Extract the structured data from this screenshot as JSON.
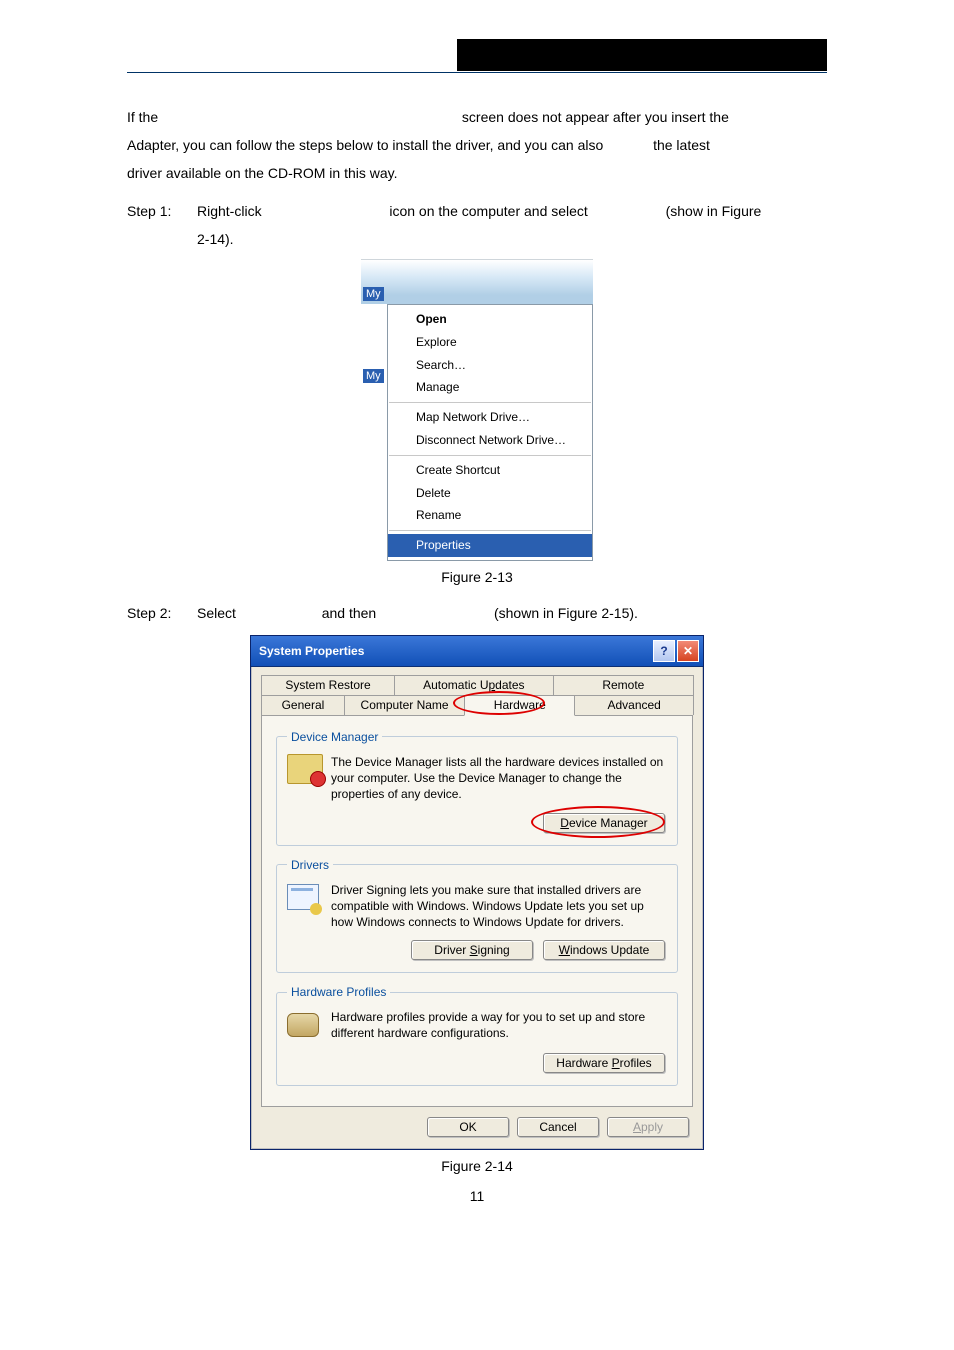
{
  "body": {
    "para1_a": "If the",
    "para1_b": "screen does not appear after you insert the",
    "para2_a": "Adapter, you can follow the steps below to install the driver, and you can also",
    "para2_b": "the latest",
    "para3": "driver available on the CD-ROM in this way.",
    "step1_label": "Step 1:",
    "step1_a": "Right-click",
    "step1_b": "icon on the computer and select",
    "step1_c": "(show in Figure",
    "step1_d": "2-14).",
    "step2_label": "Step 2:",
    "step2_a": "Select",
    "step2_b": "and then",
    "step2_c": "(shown in Figure   2-15)."
  },
  "captions": {
    "fig213": "Figure 2-13",
    "fig214": "Figure 2-14",
    "page": "11"
  },
  "context_menu": {
    "side1": "My",
    "side2": "My",
    "items1": [
      "Open",
      "Explore",
      "Search…",
      "Manage"
    ],
    "items2": [
      "Map Network Drive…",
      "Disconnect Network Drive…"
    ],
    "items3": [
      "Create Shortcut",
      "Delete",
      "Rename"
    ],
    "highlight": "Properties"
  },
  "dialog": {
    "title": "System Properties",
    "tabs_back": [
      "System Restore",
      "Automatic Updates",
      "Remote"
    ],
    "tabs_back_u": [
      "",
      "p",
      ""
    ],
    "tabs_front": [
      "General",
      "Computer Name",
      "Hardware",
      "Advanced"
    ],
    "device_mgr": {
      "legend": "Device Manager",
      "text": "The Device Manager lists all the hardware devices installed on your computer. Use the Device Manager to change the properties of any device.",
      "button": "Device Manager",
      "button_u": "D"
    },
    "drivers": {
      "legend": "Drivers",
      "text": "Driver Signing lets you make sure that installed drivers are compatible with Windows. Windows Update lets you set up how Windows connects to Windows Update for drivers.",
      "btn1": "Driver Signing",
      "btn1_u": "S",
      "btn2": "Windows Update",
      "btn2_u": "W"
    },
    "hwprofiles": {
      "legend": "Hardware Profiles",
      "text": "Hardware profiles provide a way for you to set up and store different hardware configurations.",
      "button": "Hardware Profiles",
      "button_u": "P"
    },
    "buttons": {
      "ok": "OK",
      "cancel": "Cancel",
      "apply": "Apply"
    }
  }
}
